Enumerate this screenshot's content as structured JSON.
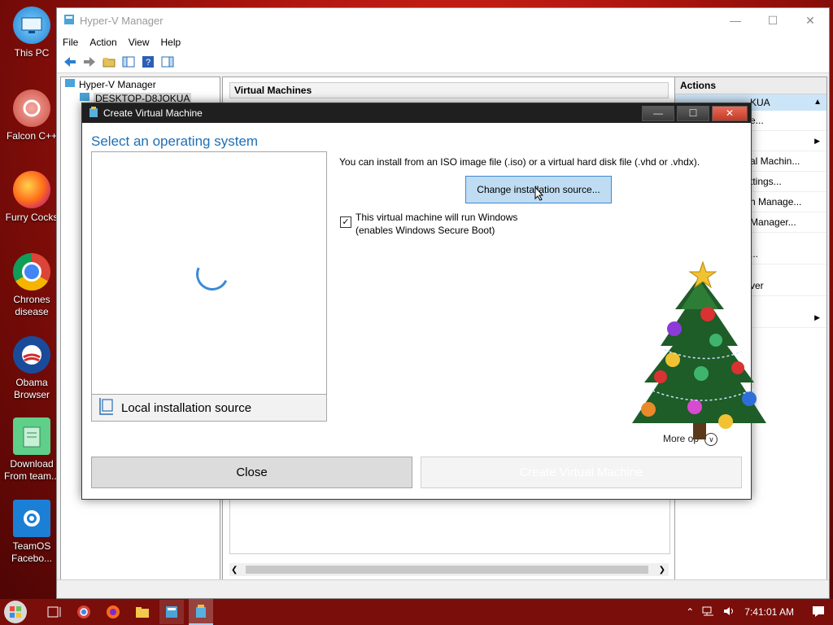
{
  "desktop": {
    "icons": [
      {
        "label": "This PC"
      },
      {
        "label": "Falcon C++"
      },
      {
        "label": "Furry Cocks"
      },
      {
        "label": "Chrones disease"
      },
      {
        "label": "Obama Browser"
      },
      {
        "label": "Download From team..."
      },
      {
        "label": "TeamOS Facebo..."
      }
    ]
  },
  "hyperv": {
    "title": "Hyper-V Manager",
    "menu": [
      "File",
      "Action",
      "View",
      "Help"
    ],
    "tree": {
      "root": "Hyper-V Manager",
      "child": "DESKTOP-D8JOKUA"
    },
    "center_header": "Virtual Machines",
    "actions": {
      "header": "Actions",
      "selected": "KUA",
      "items": [
        "e...",
        "",
        "al Machin...",
        "ttings...",
        "h Manage...",
        "Manager...",
        "...",
        "ver",
        ""
      ]
    }
  },
  "dialog": {
    "title": "Create Virtual Machine",
    "heading": "Select an operating system",
    "local_source": "Local installation source",
    "info_text": "You can install from an ISO image file (.iso) or a virtual hard disk file (.vhd or .vhdx).",
    "change_button": "Change installation source...",
    "checkbox_checked": true,
    "checkbox_line1": "This virtual machine will run Windows",
    "checkbox_line2": "(enables Windows Secure Boot)",
    "more_options": "More op",
    "close_button": "Close",
    "create_button": "Create Virtual Machine"
  },
  "taskbar": {
    "clock": "7:41:01 AM"
  },
  "colors": {
    "accent": "#1e6fb5",
    "dialog_title_bg": "#1f1f1f",
    "desktop_bg": "#a4130d"
  }
}
